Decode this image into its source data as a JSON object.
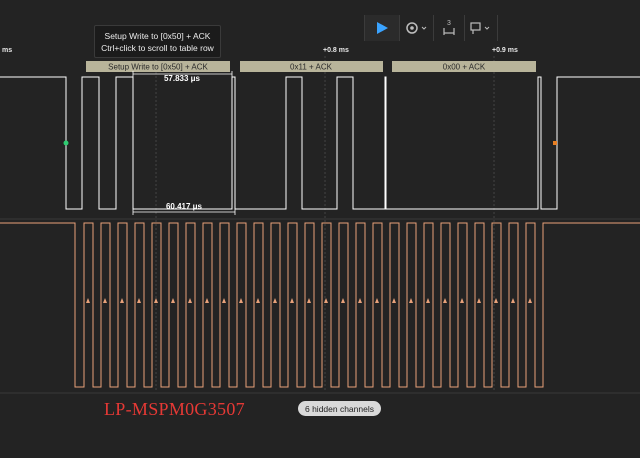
{
  "toolbar": {
    "icons": [
      "play-icon",
      "settings-icon",
      "measure-icon",
      "annotation-icon"
    ],
    "measure_count": "3",
    "accent": "#3aa3ff"
  },
  "timeline": {
    "ticks": [
      "ms",
      "+0.8 ms",
      "+0.9 ms"
    ]
  },
  "tooltip": {
    "title": "Setup Write to [0x50] + ACK",
    "hint": "Ctrl+click to scroll to table row"
  },
  "protocol_frames": [
    {
      "label": "Setup Write to [0x50] + ACK"
    },
    {
      "label": "0x11 + ACK"
    },
    {
      "label": "0x00 + ACK"
    }
  ],
  "measurements": {
    "upper": "57.833 μs",
    "lower": "60.417 μs"
  },
  "channels": {
    "sda_color": "#ffffff",
    "scl_color": "#e8a27a",
    "frame_color": "#b8b49a",
    "start_marker_color": "#2ecc71",
    "stop_marker_color": "#e67e22"
  },
  "device_label": "LP-MSPM0G3507",
  "hidden_channels": "6 hidden channels"
}
